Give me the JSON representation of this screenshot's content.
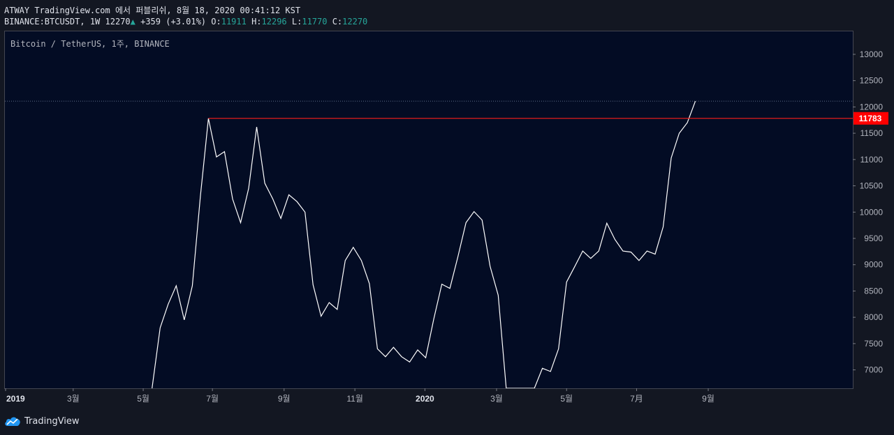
{
  "header": {
    "line1": "ATWAY TradingView.com 에서 퍼블리쉬, 8월 18, 2020 00:41:12 KST",
    "symbol": "BINANCE:BTCUSDT,",
    "interval": "1W",
    "last_price": "12270",
    "change": "+359 (+3.01%)",
    "open_label": "O:",
    "open": "11911",
    "high_label": "H:",
    "high": "12296",
    "low_label": "L:",
    "low": "11770",
    "close_label": "C:",
    "close": "12270"
  },
  "legend": "Bitcoin / TetherUS, 1주, BINANCE",
  "footer": {
    "brand": "TradingView"
  },
  "colors": {
    "background": "#131722",
    "plot_background": "#030c24",
    "line": "#ffffff",
    "resistance": "#e01b1b",
    "accent_up": "#26a69a"
  },
  "chart_data": {
    "type": "line",
    "ylim": [
      6650,
      13450
    ],
    "yticks": [
      7000,
      7500,
      8000,
      8500,
      9000,
      9500,
      10000,
      10500,
      11000,
      11500,
      12000,
      12500,
      13000
    ],
    "xlim": [
      0,
      105
    ],
    "xticks": [
      {
        "label": "2019",
        "x": 0,
        "bold": true
      },
      {
        "label": "3월",
        "x": 8.4
      },
      {
        "label": "5월",
        "x": 17.1
      },
      {
        "label": "7월",
        "x": 25.7
      },
      {
        "label": "9월",
        "x": 34.6
      },
      {
        "label": "11월",
        "x": 43.4
      },
      {
        "label": "2020",
        "x": 52.1,
        "bold": true
      },
      {
        "label": "3월",
        "x": 61
      },
      {
        "label": "5월",
        "x": 69.7
      },
      {
        "label": "7月",
        "x": 78.4
      },
      {
        "label": "9월",
        "x": 87.3
      }
    ],
    "price_marker": {
      "value": 11783,
      "label": "11783",
      "x_start": 25.2
    },
    "last_price_line": 12110,
    "series": [
      {
        "values": [
          [
            18.2,
            6650
          ],
          [
            19.2,
            7800
          ],
          [
            20.2,
            8250
          ],
          [
            21.2,
            8600
          ],
          [
            22.2,
            7950
          ],
          [
            23.2,
            8600
          ],
          [
            24.2,
            10300
          ],
          [
            25.2,
            11783
          ],
          [
            26.2,
            11050
          ],
          [
            27.2,
            11150
          ],
          [
            28.2,
            10250
          ],
          [
            29.2,
            9800
          ],
          [
            30.2,
            10450
          ],
          [
            31.2,
            11620
          ],
          [
            32.2,
            10550
          ],
          [
            33.2,
            10250
          ],
          [
            34.2,
            9880
          ],
          [
            35.2,
            10330
          ],
          [
            36.2,
            10200
          ],
          [
            37.2,
            10000
          ],
          [
            38.2,
            8620
          ],
          [
            39.2,
            8020
          ],
          [
            40.2,
            8280
          ],
          [
            41.2,
            8150
          ],
          [
            42.2,
            9080
          ],
          [
            43.2,
            9330
          ],
          [
            44.2,
            9080
          ],
          [
            45.2,
            8640
          ],
          [
            46.2,
            7400
          ],
          [
            47.2,
            7250
          ],
          [
            48.2,
            7430
          ],
          [
            49.2,
            7250
          ],
          [
            50.2,
            7150
          ],
          [
            51.2,
            7380
          ],
          [
            52.2,
            7230
          ],
          [
            53.2,
            7970
          ],
          [
            54.2,
            8630
          ],
          [
            55.2,
            8550
          ],
          [
            56.2,
            9150
          ],
          [
            57.2,
            9800
          ],
          [
            58.2,
            10010
          ],
          [
            59.2,
            9850
          ],
          [
            60.2,
            8970
          ],
          [
            61.2,
            8420
          ],
          [
            62.2,
            6650
          ],
          [
            65.7,
            6650
          ],
          [
            66.7,
            7030
          ],
          [
            67.7,
            6970
          ],
          [
            68.7,
            7400
          ],
          [
            69.7,
            8670
          ],
          [
            70.7,
            8960
          ],
          [
            71.7,
            9260
          ],
          [
            72.7,
            9120
          ],
          [
            73.7,
            9260
          ],
          [
            74.7,
            9790
          ],
          [
            75.7,
            9480
          ],
          [
            76.7,
            9260
          ],
          [
            77.7,
            9240
          ],
          [
            78.7,
            9080
          ],
          [
            79.7,
            9260
          ],
          [
            80.7,
            9200
          ],
          [
            81.7,
            9720
          ],
          [
            82.7,
            11030
          ],
          [
            83.7,
            11500
          ],
          [
            84.7,
            11700
          ],
          [
            85.7,
            12110
          ]
        ]
      }
    ]
  }
}
